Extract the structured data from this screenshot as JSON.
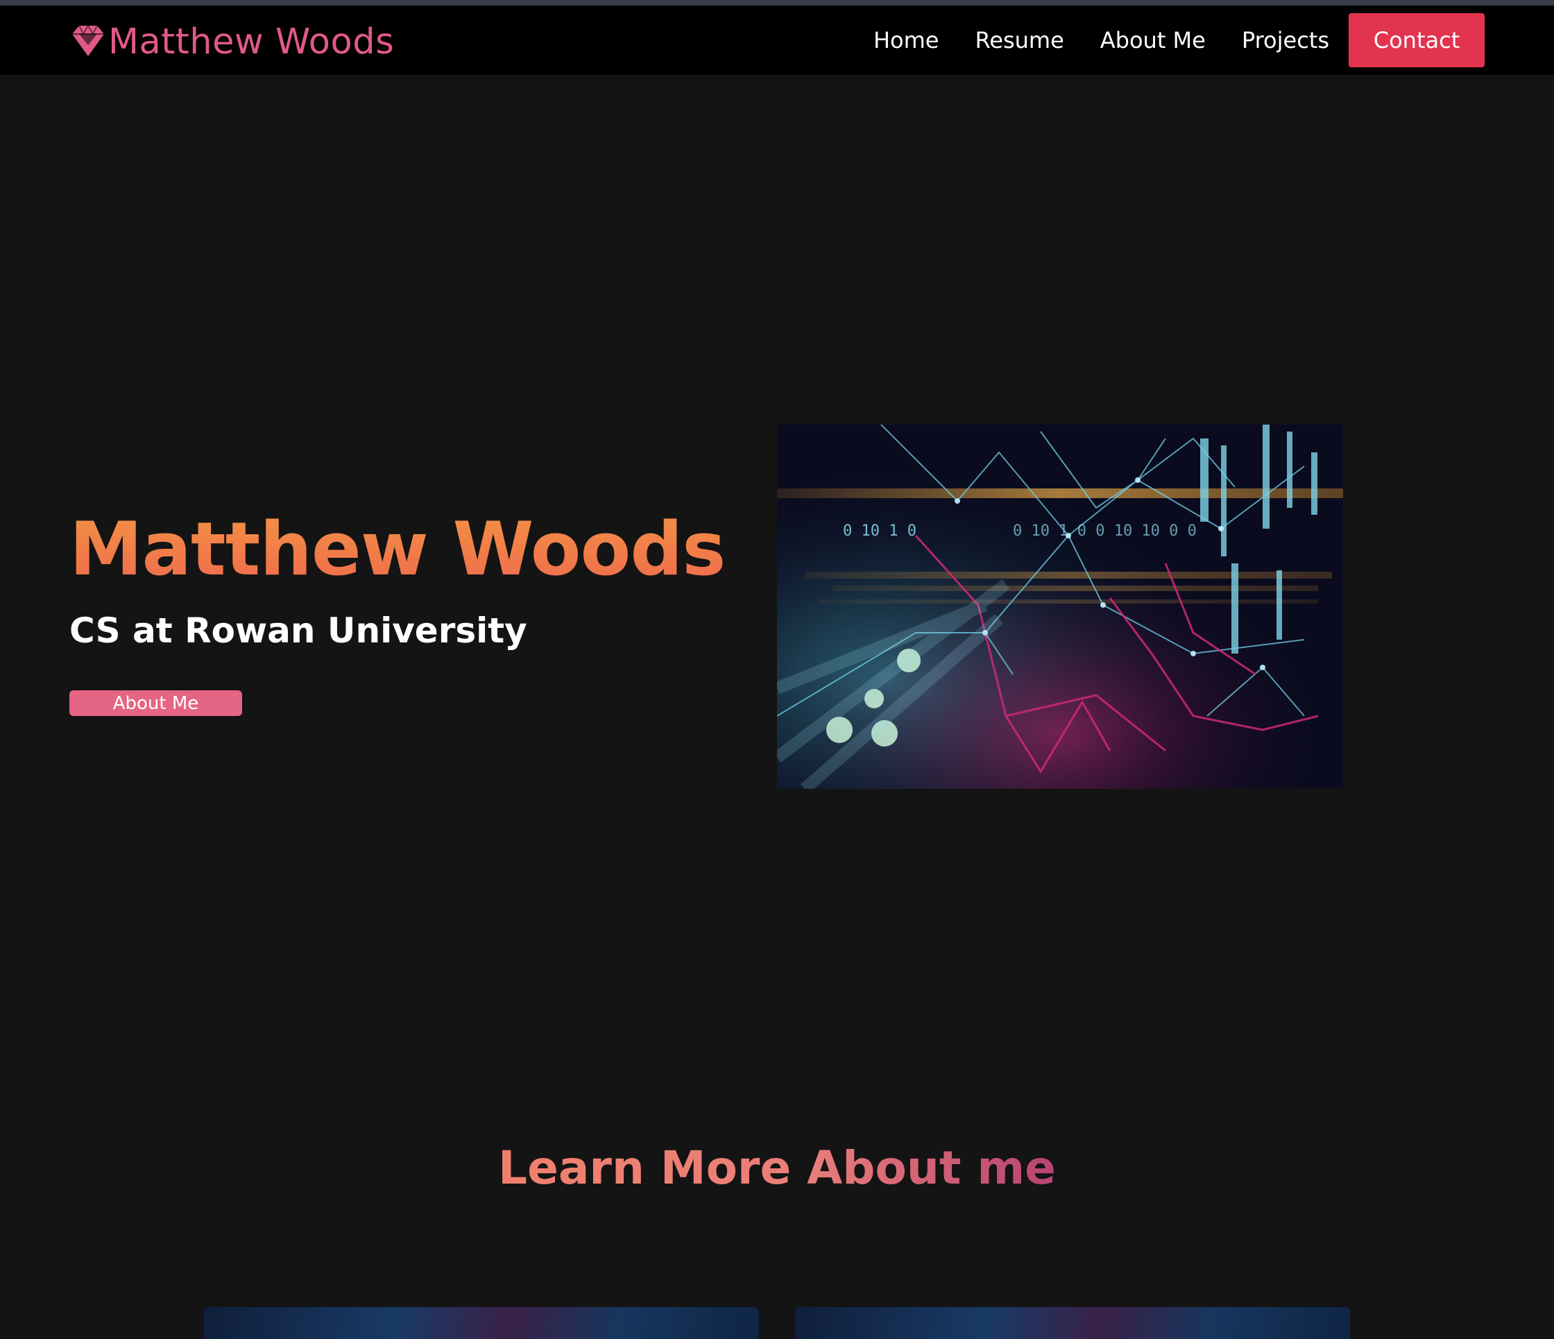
{
  "navbar": {
    "brand": "Matthew Woods",
    "brand_icon": "gem-icon",
    "links": [
      "Home",
      "Resume",
      "About Me",
      "Projects"
    ],
    "contact_label": "Contact"
  },
  "hero": {
    "title": "Matthew Woods",
    "subtitle": "CS at Rowan University",
    "button_label": "About Me",
    "image_binary_row": "0 10 1 0",
    "image_binary_row2": "0 10 1 0 0 10 10 0 0"
  },
  "section": {
    "title": "Learn More About me"
  },
  "colors": {
    "accent": "#e3344f",
    "brand_pink": "#e15a86",
    "title_orange": "#f0824a",
    "background": "#141414",
    "navbar": "#000000"
  }
}
